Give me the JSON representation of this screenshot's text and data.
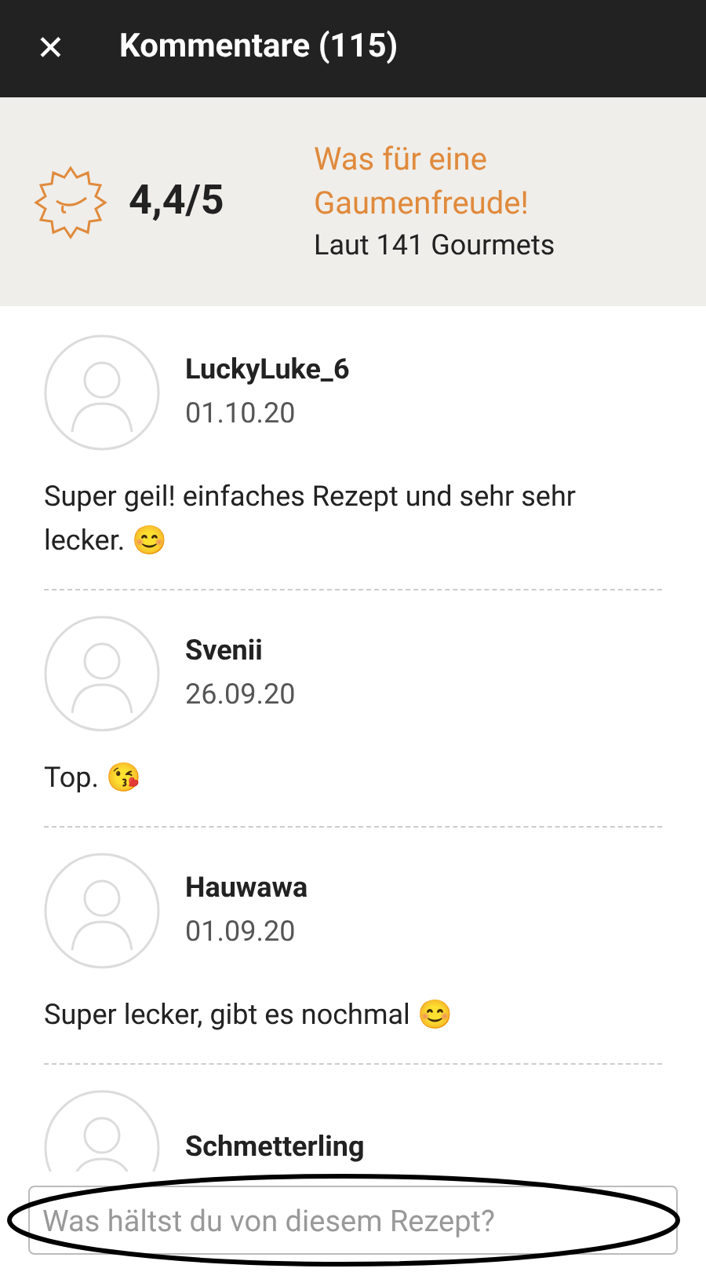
{
  "header": {
    "close": "✕",
    "title": "Kommentare (115)"
  },
  "rating": {
    "score": "4,4/5",
    "verdict": "Was für eine Gaumenfreude!",
    "count": "Laut 141 Gourmets"
  },
  "comments": [
    {
      "author": "LuckyLuke_6",
      "date": "01.10.20",
      "text": "Super geil! einfaches Rezept und sehr sehr lecker. 😊"
    },
    {
      "author": "Svenii",
      "date": "26.09.20",
      "text": "Top. 😘"
    },
    {
      "author": "Hauwawa",
      "date": "01.09.20",
      "text": "Super lecker, gibt es nochmal 😊"
    },
    {
      "author": "Schmetterling"
    }
  ],
  "comment_field": {
    "placeholder": "Was hältst du von diesem Rezept?"
  }
}
